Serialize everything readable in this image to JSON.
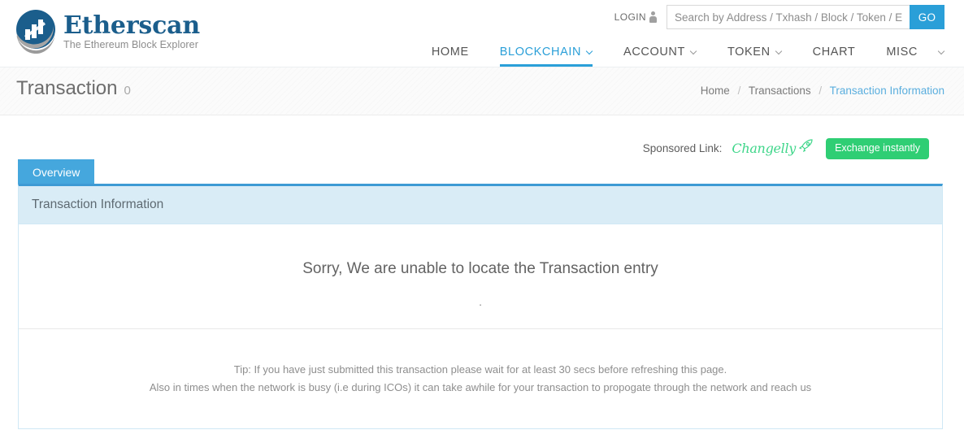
{
  "header": {
    "logo": {
      "word": "Etherscan",
      "tagline": "The Ethereum Block Explorer",
      "icon": "etherscan-logo-icon"
    },
    "login_label": "LOGIN",
    "login_icon": "person-icon",
    "search": {
      "placeholder": "Search by Address / Txhash / Block / Token / Ens",
      "value": "",
      "button_label": "GO"
    },
    "nav": [
      {
        "label": "HOME",
        "has_caret": false,
        "active": false
      },
      {
        "label": "BLOCKCHAIN",
        "has_caret": true,
        "active": true
      },
      {
        "label": "ACCOUNT",
        "has_caret": true,
        "active": false
      },
      {
        "label": "TOKEN",
        "has_caret": true,
        "active": false
      },
      {
        "label": "CHART",
        "has_caret": false,
        "active": false
      },
      {
        "label": "MISC",
        "has_caret": true,
        "active": false
      }
    ]
  },
  "title_bar": {
    "title": "Transaction",
    "subtitle": "0",
    "breadcrumb": {
      "home": "Home",
      "transactions": "Transactions",
      "current": "Transaction Information",
      "separator": "/"
    }
  },
  "sponsor": {
    "label": "Sponsored Link:",
    "brand": "Changelly",
    "brand_icon": "rocket-icon",
    "button_label": "Exchange instantly"
  },
  "main": {
    "tab_label": "Overview",
    "panel_title": "Transaction Information",
    "error_message": "Sorry, We are unable to locate the Transaction entry",
    "error_dot": ".",
    "tip_line_1": "Tip: If you have just submitted this transaction please wait for at least 30 secs before refreshing this page.",
    "tip_line_2": "Also in times when the network is busy (i.e during ICOs) it can take awhile for your transaction to propogate through the network and reach us"
  },
  "colors": {
    "brand_blue": "#1b5e8c",
    "accent_blue": "#2a9fd8",
    "panel_blue": "#d9ecf6",
    "green": "#2fce74"
  }
}
